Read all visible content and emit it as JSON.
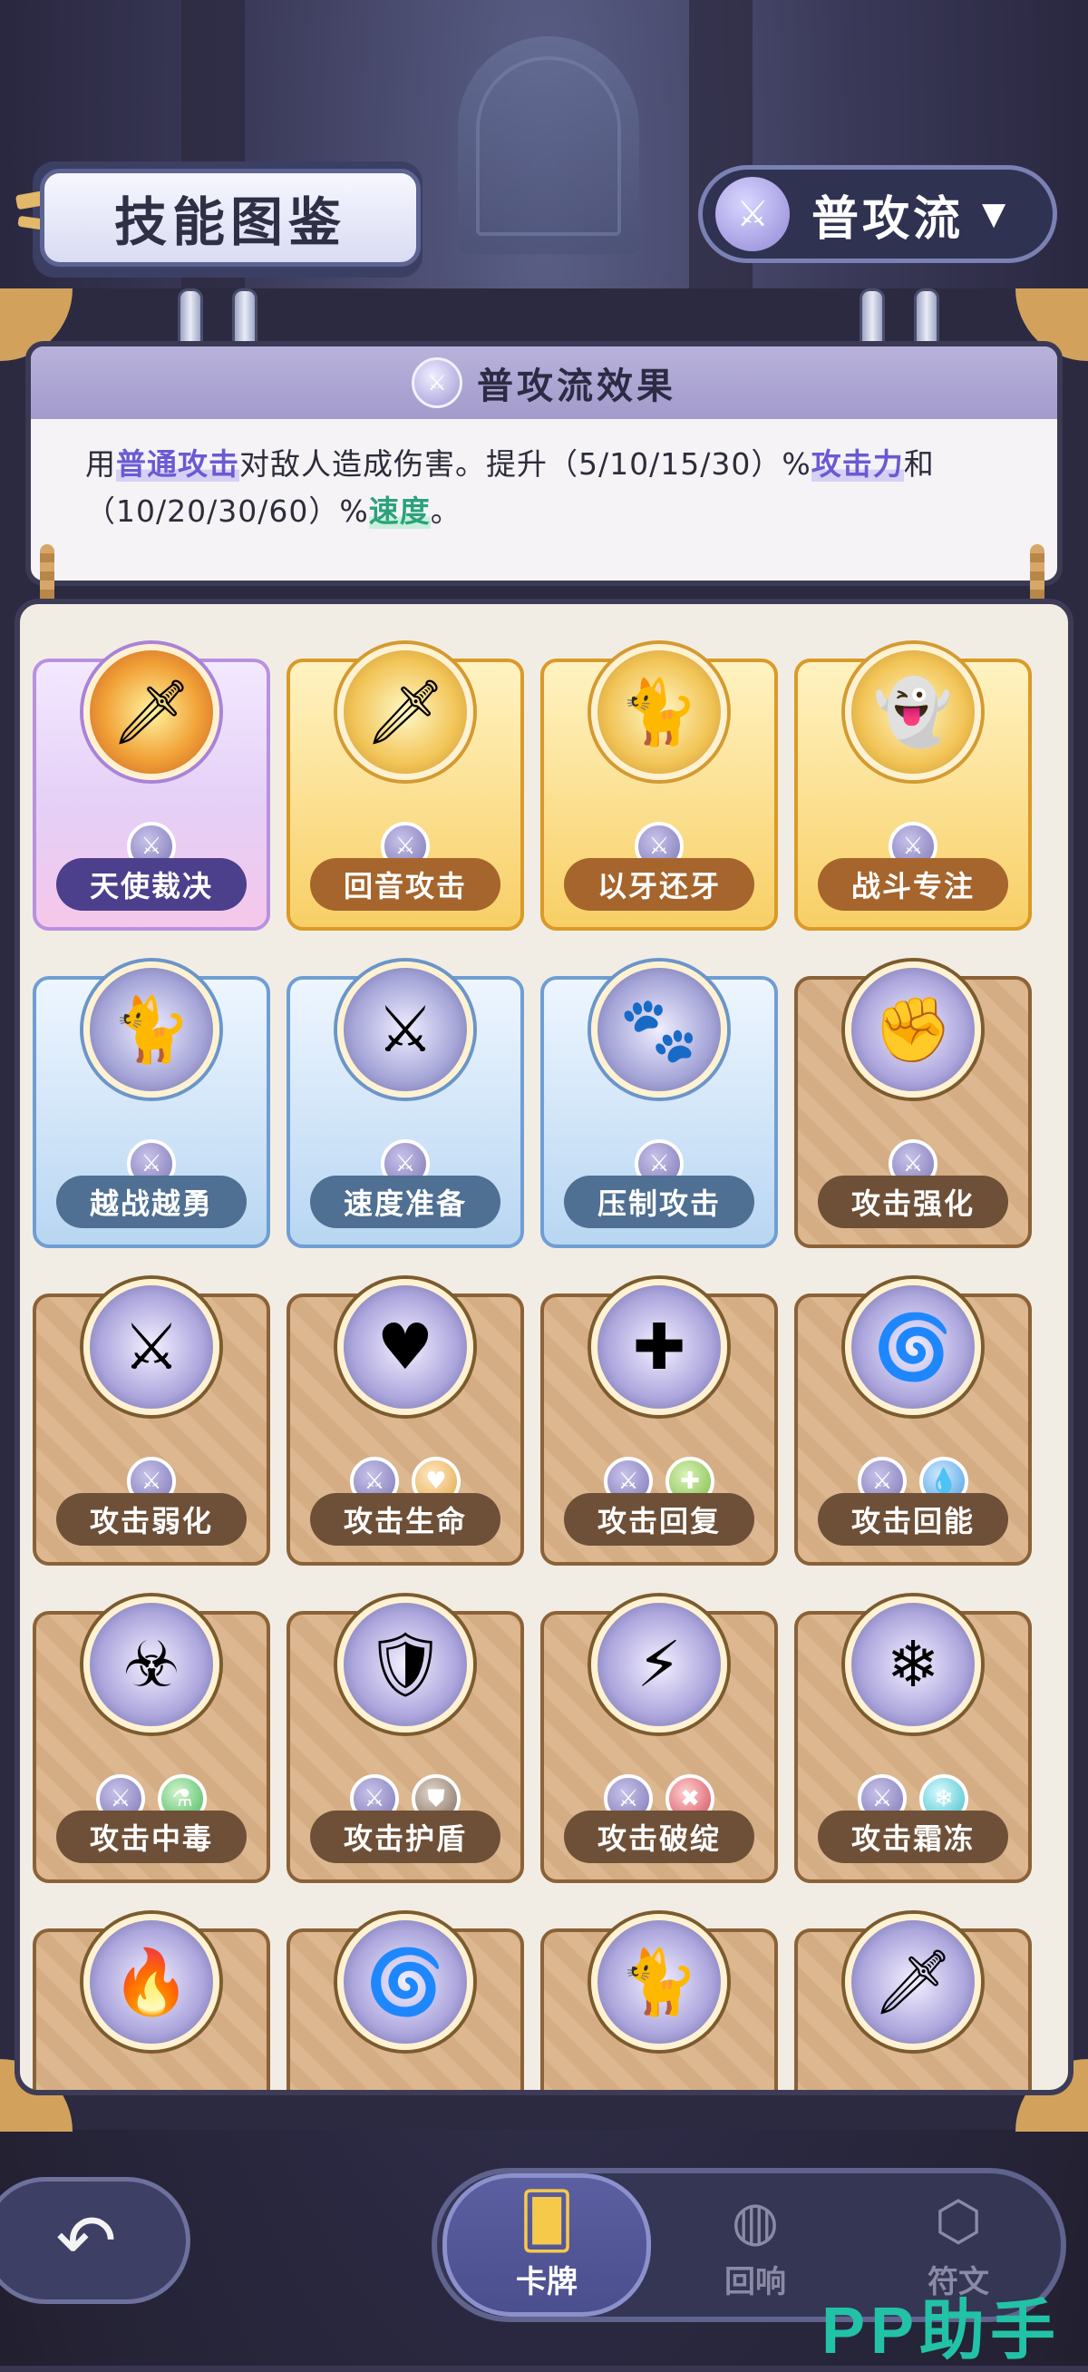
{
  "header": {
    "title": "技能图鉴",
    "flow_selector": {
      "label": "普攻流",
      "icon": "sword-icon"
    }
  },
  "effect": {
    "title": "普攻流效果",
    "desc_part1": "用",
    "desc_hl1": "普通攻击",
    "desc_part2": "对敌人造成伤害。提升（5/10/15/30）%",
    "desc_hl2": "攻击力",
    "desc_part3": "和（10/20/30/60）%",
    "desc_hl3": "速度",
    "desc_part4": "。"
  },
  "cards": [
    {
      "name": "天使裁决",
      "rarity": "purple",
      "tags": [
        "sword"
      ],
      "icon": "sword-icon"
    },
    {
      "name": "回音攻击",
      "rarity": "gold",
      "tags": [
        "sword"
      ],
      "icon": "sword-icon"
    },
    {
      "name": "以牙还牙",
      "rarity": "gold",
      "tags": [
        "sword"
      ],
      "icon": "cat-icon"
    },
    {
      "name": "战斗专注",
      "rarity": "gold",
      "tags": [
        "sword"
      ],
      "icon": "ghost-icon"
    },
    {
      "name": "越战越勇",
      "rarity": "blue",
      "tags": [
        "sword"
      ],
      "icon": "cat-icon"
    },
    {
      "name": "速度准备",
      "rarity": "blue",
      "tags": [
        "sword"
      ],
      "icon": "blade-icon"
    },
    {
      "name": "压制攻击",
      "rarity": "blue",
      "tags": [
        "sword"
      ],
      "icon": "claw-icon"
    },
    {
      "name": "攻击强化",
      "rarity": "brown",
      "tags": [
        "sword"
      ],
      "icon": "fist-icon"
    },
    {
      "name": "攻击弱化",
      "rarity": "brown",
      "tags": [
        "sword"
      ],
      "icon": "broken-sword-icon"
    },
    {
      "name": "攻击生命",
      "rarity": "brown",
      "tags": [
        "sword",
        "life"
      ],
      "icon": "heart-cat-icon"
    },
    {
      "name": "攻击回复",
      "rarity": "brown",
      "tags": [
        "sword",
        "heal"
      ],
      "icon": "heal-sword-icon"
    },
    {
      "name": "攻击回能",
      "rarity": "brown",
      "tags": [
        "sword",
        "energy"
      ],
      "icon": "vortex-icon"
    },
    {
      "name": "攻击中毒",
      "rarity": "brown",
      "tags": [
        "sword",
        "poison"
      ],
      "icon": "poison-icon"
    },
    {
      "name": "攻击护盾",
      "rarity": "brown",
      "tags": [
        "sword",
        "shield"
      ],
      "icon": "shield-icon"
    },
    {
      "name": "攻击破绽",
      "rarity": "brown",
      "tags": [
        "sword",
        "break"
      ],
      "icon": "slash-icon"
    },
    {
      "name": "攻击霜冻",
      "rarity": "brown",
      "tags": [
        "sword",
        "frost"
      ],
      "icon": "frost-icon"
    }
  ],
  "nav": {
    "back_icon": "back-arrow-icon",
    "items": [
      {
        "label": "卡牌",
        "icon": "cards-icon",
        "active": true
      },
      {
        "label": "回响",
        "icon": "echo-icon",
        "active": false
      },
      {
        "label": "符文",
        "icon": "rune-icon",
        "active": false
      }
    ]
  },
  "watermark": "PP助手"
}
